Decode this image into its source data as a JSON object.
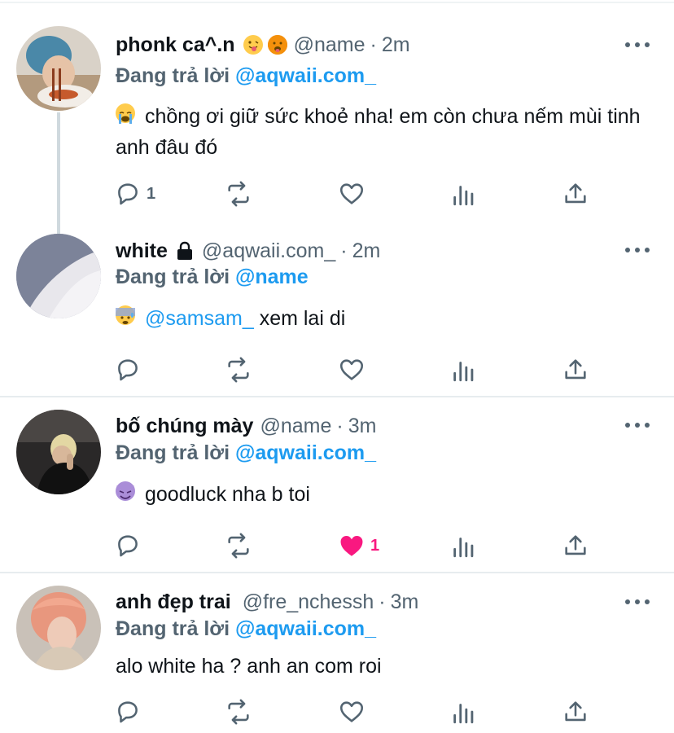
{
  "tweets": [
    {
      "display_name": "phonk ca^.n",
      "name_emojis": [
        "tongue-out-emoji",
        "hot-face-emoji"
      ],
      "handle": "@name",
      "separator": "·",
      "time": "2m",
      "reply_prefix": "Đang trả lời",
      "reply_to": "@aqwaii.com_",
      "text": "chồng ơi giữ sức khoẻ nha! em còn chưa nếm mùi tinh anh đâu đó",
      "text_emoji": "crying-face-emoji",
      "reply_count": "1",
      "like_count": "",
      "liked": false
    },
    {
      "display_name": "white",
      "name_icon": "lock-icon",
      "handle": "@aqwaii.com_",
      "separator": "·",
      "time": "2m",
      "reply_prefix": "Đang trả lời",
      "reply_to": "@name",
      "mention": "@samsam_",
      "text": "xem lai di",
      "text_emoji": "anxious-face-emoji",
      "reply_count": "",
      "like_count": "",
      "liked": false
    },
    {
      "display_name": "bố chúng mày",
      "handle": "@name",
      "separator": "·",
      "time": "3m",
      "reply_prefix": "Đang trả lời",
      "reply_to": "@aqwaii.com_",
      "text": "goodluck nha b toi",
      "text_emoji": "smiling-devil-emoji",
      "reply_count": "",
      "like_count": "1",
      "liked": true
    },
    {
      "display_name": "anh đẹp trai",
      "handle": "@fre_nchessh",
      "separator": "·",
      "time": "3m",
      "reply_prefix": "Đang trả lời",
      "reply_to": "@aqwaii.com_",
      "text": "alo white ha ? anh an com roi",
      "reply_count": "",
      "like_count": "",
      "liked": false
    }
  ],
  "colors": {
    "accent": "#1d9bf0",
    "like": "#f91880",
    "secondary_text": "#536471",
    "primary_text": "#0f1419"
  }
}
